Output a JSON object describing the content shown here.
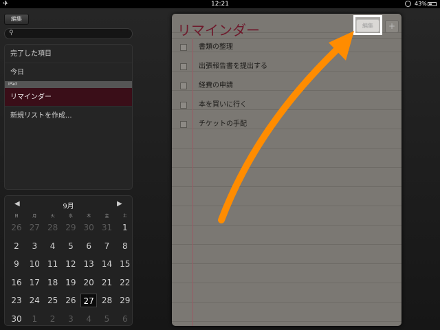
{
  "status_bar": {
    "time": "12:21",
    "battery_percent": "43%",
    "battery_level": 0.43,
    "airplane_icon": "airplane-icon",
    "lock_icon": "rotation-lock-icon"
  },
  "sidebar": {
    "edit_label": "編集",
    "search_placeholder": "",
    "items": [
      {
        "label": "完了した項目"
      },
      {
        "label": "今日"
      },
      {
        "label": "リマインダー",
        "selected": true
      },
      {
        "label": "新規リストを作成..."
      }
    ],
    "section_header": "iPad"
  },
  "calendar": {
    "month": "9月",
    "weekdays": [
      "日",
      "月",
      "火",
      "水",
      "木",
      "金",
      "土"
    ],
    "weeks": [
      [
        {
          "d": "26",
          "m": true
        },
        {
          "d": "27",
          "m": true
        },
        {
          "d": "28",
          "m": true
        },
        {
          "d": "29",
          "m": true
        },
        {
          "d": "30",
          "m": true
        },
        {
          "d": "31",
          "m": true
        },
        {
          "d": "1"
        }
      ],
      [
        {
          "d": "2"
        },
        {
          "d": "3"
        },
        {
          "d": "4"
        },
        {
          "d": "5"
        },
        {
          "d": "6"
        },
        {
          "d": "7"
        },
        {
          "d": "8"
        }
      ],
      [
        {
          "d": "9"
        },
        {
          "d": "10"
        },
        {
          "d": "11"
        },
        {
          "d": "12"
        },
        {
          "d": "13"
        },
        {
          "d": "14"
        },
        {
          "d": "15"
        }
      ],
      [
        {
          "d": "16"
        },
        {
          "d": "17"
        },
        {
          "d": "18"
        },
        {
          "d": "19"
        },
        {
          "d": "20"
        },
        {
          "d": "21"
        },
        {
          "d": "22"
        }
      ],
      [
        {
          "d": "23"
        },
        {
          "d": "24"
        },
        {
          "d": "25"
        },
        {
          "d": "26"
        },
        {
          "d": "27",
          "today": true
        },
        {
          "d": "28"
        },
        {
          "d": "29"
        }
      ],
      [
        {
          "d": "30"
        },
        {
          "d": "1",
          "m": true
        },
        {
          "d": "2",
          "m": true
        },
        {
          "d": "3",
          "m": true
        },
        {
          "d": "4",
          "m": true
        },
        {
          "d": "5",
          "m": true
        },
        {
          "d": "6",
          "m": true
        }
      ]
    ]
  },
  "notepad": {
    "title": "リマインダー",
    "edit_label": "編集",
    "add_label": "+",
    "tasks": [
      {
        "label": "書類の整理"
      },
      {
        "label": "出張報告書を提出する"
      },
      {
        "label": "経費の申請"
      },
      {
        "label": "本を買いに行く"
      },
      {
        "label": "チケットの手配"
      }
    ]
  },
  "annotation": {
    "highlight_color": "#ffffff",
    "arrow_color": "#ff8c00"
  }
}
